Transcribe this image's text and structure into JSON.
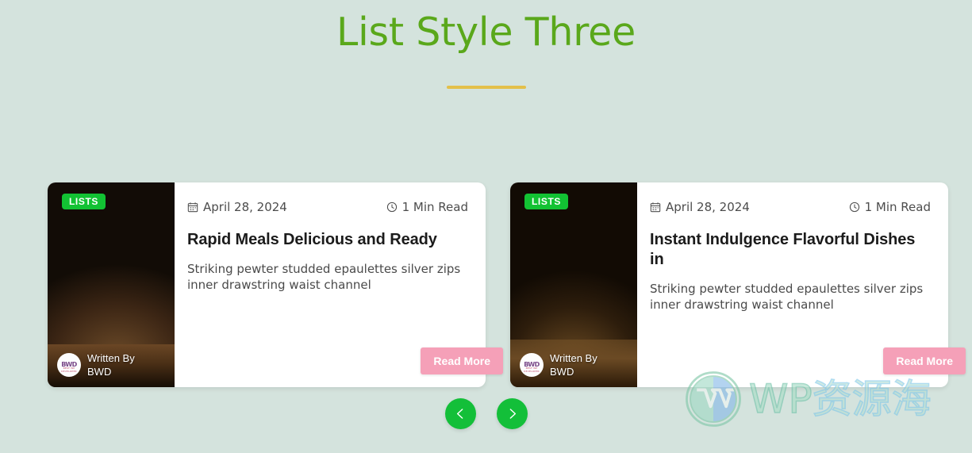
{
  "theme": {
    "background": "#d4e3dd",
    "title_color": "#5aa81b",
    "divider_color": "#e3c04a",
    "badge_color": "#12c233",
    "button_color": "#f5a0b8",
    "nav_color": "#13bf39"
  },
  "header": {
    "title": "List Style Three"
  },
  "cards": [
    {
      "badge": "LISTS",
      "date": "April 28, 2024",
      "read_time": "1 Min Read",
      "title": "Rapid Meals Delicious and Ready",
      "description": "Striking pewter studded epaulettes silver zips inner drawstring waist channel",
      "author_label": "Written By",
      "author_name": "BWD",
      "button_label": "Read More",
      "avatar_mark": "BWD",
      "avatar_sub": "BEST WP DEVELOPER"
    },
    {
      "badge": "LISTS",
      "date": "April 28, 2024",
      "read_time": "1 Min Read",
      "title": "Instant Indulgence Flavorful Dishes in",
      "description": "Striking pewter studded epaulettes silver zips inner drawstring waist channel",
      "author_label": "Written By",
      "author_name": "BWD",
      "button_label": "Read More",
      "avatar_mark": "BWD",
      "avatar_sub": "BEST WP DEVELOPER"
    }
  ],
  "navigation": {
    "previous_label": "Previous",
    "next_label": "Next"
  },
  "watermark": {
    "text_latin": "WP",
    "text_cjk": "资源海"
  }
}
